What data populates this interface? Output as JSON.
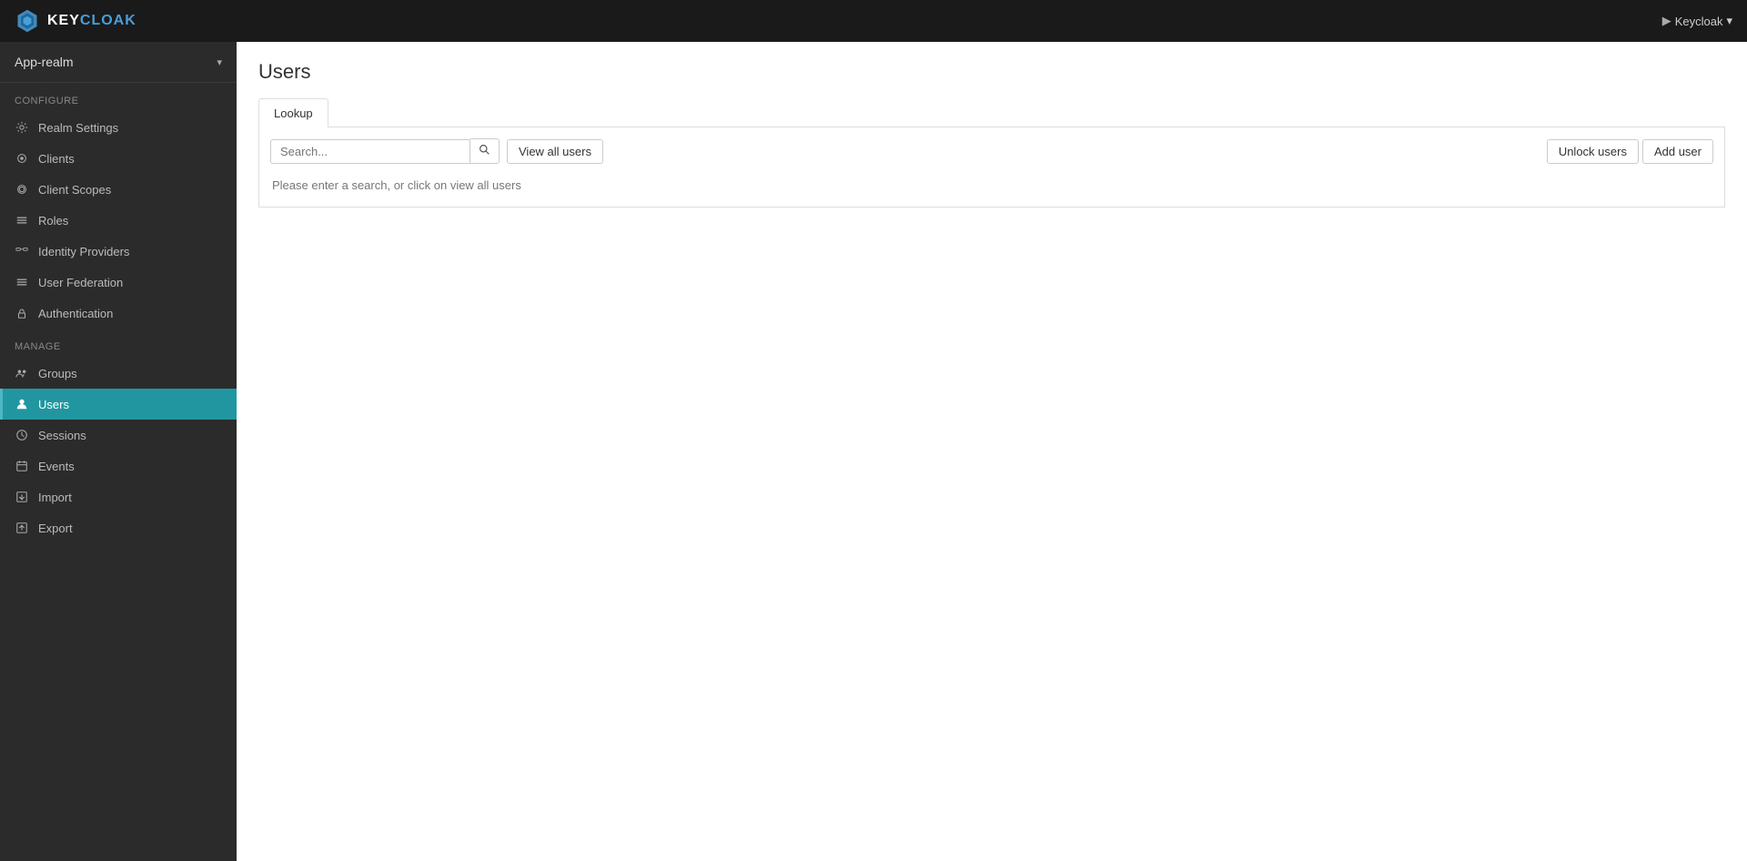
{
  "navbar": {
    "brand": "KEYCLOAK",
    "brand_key": "KEY",
    "brand_cloak": "CLOAK",
    "user_label": "Keycloak",
    "user_icon": "▾"
  },
  "sidebar": {
    "realm_name": "App-realm",
    "realm_chevron": "▾",
    "configure_label": "Configure",
    "manage_label": "Manage",
    "configure_items": [
      {
        "id": "realm-settings",
        "label": "Realm Settings",
        "icon": "⚙"
      },
      {
        "id": "clients",
        "label": "Clients",
        "icon": "◉"
      },
      {
        "id": "client-scopes",
        "label": "Client Scopes",
        "icon": "◎"
      },
      {
        "id": "roles",
        "label": "Roles",
        "icon": "≡"
      },
      {
        "id": "identity-providers",
        "label": "Identity Providers",
        "icon": "⇌"
      },
      {
        "id": "user-federation",
        "label": "User Federation",
        "icon": "≡"
      },
      {
        "id": "authentication",
        "label": "Authentication",
        "icon": "🔒"
      }
    ],
    "manage_items": [
      {
        "id": "groups",
        "label": "Groups",
        "icon": "👥"
      },
      {
        "id": "users",
        "label": "Users",
        "icon": "👤",
        "active": true
      },
      {
        "id": "sessions",
        "label": "Sessions",
        "icon": "⏱"
      },
      {
        "id": "events",
        "label": "Events",
        "icon": "📅"
      },
      {
        "id": "import",
        "label": "Import",
        "icon": "↑"
      },
      {
        "id": "export",
        "label": "Export",
        "icon": "↓"
      }
    ]
  },
  "main": {
    "page_title": "Users",
    "tabs": [
      {
        "id": "lookup",
        "label": "Lookup",
        "active": true
      }
    ],
    "search_placeholder": "Search...",
    "view_all_btn": "View all users",
    "unlock_btn": "Unlock users",
    "add_user_btn": "Add user",
    "info_text": "Please enter a search, or click on view all users"
  }
}
